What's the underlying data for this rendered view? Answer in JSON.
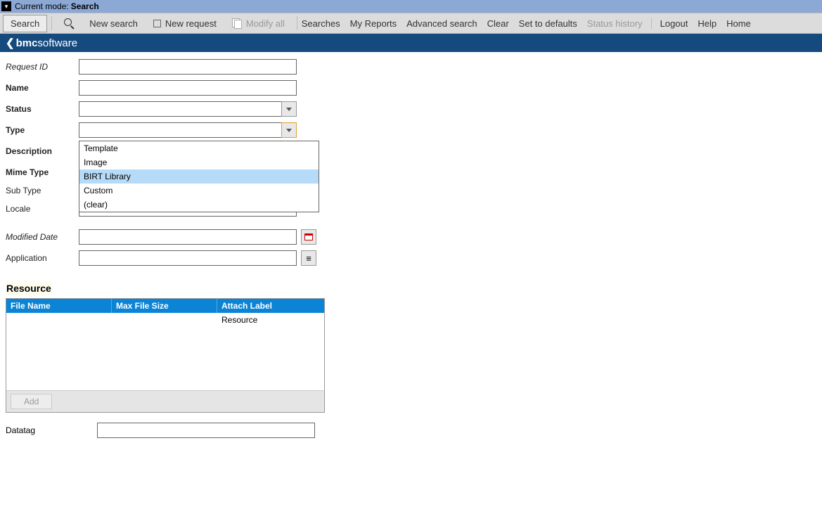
{
  "mode_bar": {
    "prefix": "Current mode:",
    "mode": "Search"
  },
  "toolbar": {
    "search": "Search",
    "new_search": "New search",
    "new_request": "New request",
    "modify_all": "Modify all",
    "links": {
      "searches": "Searches",
      "my_reports": "My Reports",
      "advanced_search": "Advanced search",
      "clear": "Clear",
      "set_defaults": "Set to defaults",
      "status_history": "Status history"
    },
    "right": {
      "logout": "Logout",
      "help": "Help",
      "home": "Home"
    }
  },
  "logo": {
    "bmc": "bmc",
    "software": "software"
  },
  "form": {
    "labels": {
      "request_id": "Request ID",
      "name": "Name",
      "status": "Status",
      "type": "Type",
      "description": "Description",
      "mime_type": "Mime Type",
      "sub_type": "Sub Type",
      "locale": "Locale",
      "modified_date": "Modified Date",
      "application": "Application"
    },
    "values": {
      "request_id": "",
      "name": "",
      "status": "",
      "type": "",
      "description": "",
      "mime_type": "",
      "sub_type": "",
      "locale": "",
      "modified_date": "",
      "application": ""
    },
    "type_options": [
      "Template",
      "Image",
      "BIRT Library",
      "Custom",
      "(clear)"
    ],
    "type_selected": "BIRT Library"
  },
  "resource": {
    "title": "Resource",
    "columns": {
      "file_name": "File Name",
      "max_size": "Max File Size",
      "attach_label": "Attach Label"
    },
    "rows": [
      {
        "file_name": "",
        "max_size": "",
        "attach_label": "Resource"
      }
    ],
    "add_button": "Add"
  },
  "datatag": {
    "label": "Datatag",
    "value": ""
  }
}
